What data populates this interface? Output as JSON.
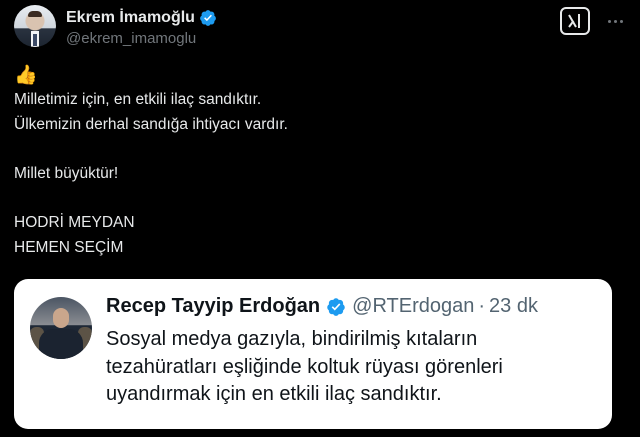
{
  "tweet": {
    "author": {
      "display_name": "Ekrem İmamoğlu",
      "handle": "@ekrem_imamoglu",
      "verified_icon": "verified-badge-icon"
    },
    "actions": {
      "grok_icon": "grok-icon",
      "more_icon": "more-dots-icon"
    },
    "emoji": "👍",
    "lines": [
      "Milletimiz için, en etkili ilaç sandıktır.",
      "Ülkemizin derhal sandığa ihtiyacı vardır.",
      "",
      "Millet büyüktür!",
      "",
      "HODRİ MEYDAN",
      "HEMEN SEÇİM"
    ]
  },
  "quoted_tweet": {
    "display_name": "Recep Tayyip Erdoğan",
    "handle": "@RTErdogan",
    "separator": "·",
    "time": "23 dk",
    "lines": [
      "Sosyal medya gazıyla, bindirilmiş kıtaların",
      "tezahüratları eşliğinde koltuk rüyası görenleri",
      "uyandırmak için en etkili ilaç sandıktır."
    ]
  },
  "colors": {
    "background": "#000000",
    "text_primary": "#e7e9ea",
    "text_secondary": "#71767b",
    "verified_blue": "#1d9bf0",
    "quote_background": "#ffffff",
    "quote_text": "#0f1419",
    "quote_secondary": "#536471"
  }
}
